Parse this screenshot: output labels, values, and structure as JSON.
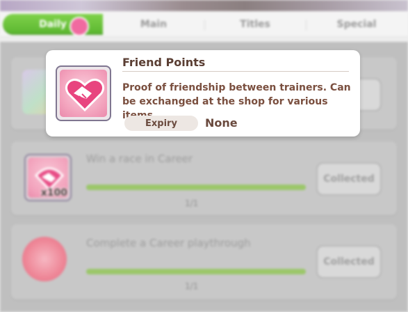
{
  "tabs": [
    {
      "label": "Daily",
      "active": true
    },
    {
      "label": "Main",
      "active": false
    },
    {
      "label": "Titles",
      "active": false
    },
    {
      "label": "Special",
      "active": false
    }
  ],
  "tab_badge": "",
  "missions": [
    {
      "title": "",
      "progress": "",
      "progress_fraction": 1,
      "button": "",
      "icon": "character-card-icon"
    },
    {
      "title": "Win a race in Career",
      "progress": "1/1",
      "progress_fraction": 1,
      "button": "Collected",
      "reward_icon": "friend-points-icon",
      "reward_qty": "x100"
    },
    {
      "title": "Complete a Career playthrough",
      "progress": "1/1",
      "progress_fraction": 1,
      "button": "Collected",
      "icon": "pink-emblem-icon"
    }
  ],
  "popup": {
    "title": "Friend Points",
    "description": "Proof of friendship between trainers. Can be exchanged at the shop for various items.",
    "expiry_label": "Expiry",
    "expiry_value": "None",
    "icon": "friend-points-handshake-icon"
  },
  "colors": {
    "tab_active": "#5ab52f",
    "badge": "#f06aa0",
    "popup_text": "#7a4f3f",
    "progress_fill": "#9bc76a"
  }
}
